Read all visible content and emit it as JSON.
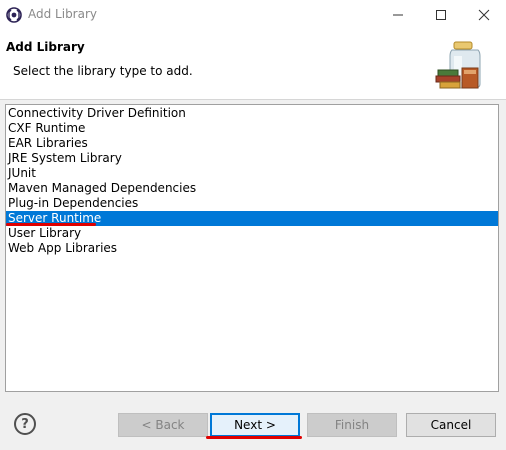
{
  "window": {
    "title": "Add Library"
  },
  "header": {
    "title": "Add Library",
    "description": "Select the library type to add."
  },
  "library_types": {
    "items": [
      "Connectivity Driver Definition",
      "CXF Runtime",
      "EAR Libraries",
      "JRE System Library",
      "JUnit",
      "Maven Managed Dependencies",
      "Plug-in Dependencies",
      "Server Runtime",
      "User Library",
      "Web App Libraries"
    ],
    "selected": "Server Runtime"
  },
  "buttons": {
    "help": "?",
    "back": "< Back",
    "next": "Next >",
    "finish": "Finish",
    "cancel": "Cancel"
  },
  "colors": {
    "selection": "#0078d7",
    "annotation": "#e00000"
  },
  "icons": [
    "eclipse-app-icon",
    "minimize-icon",
    "maximize-icon",
    "close-icon",
    "library-jar-icon",
    "help-icon"
  ]
}
